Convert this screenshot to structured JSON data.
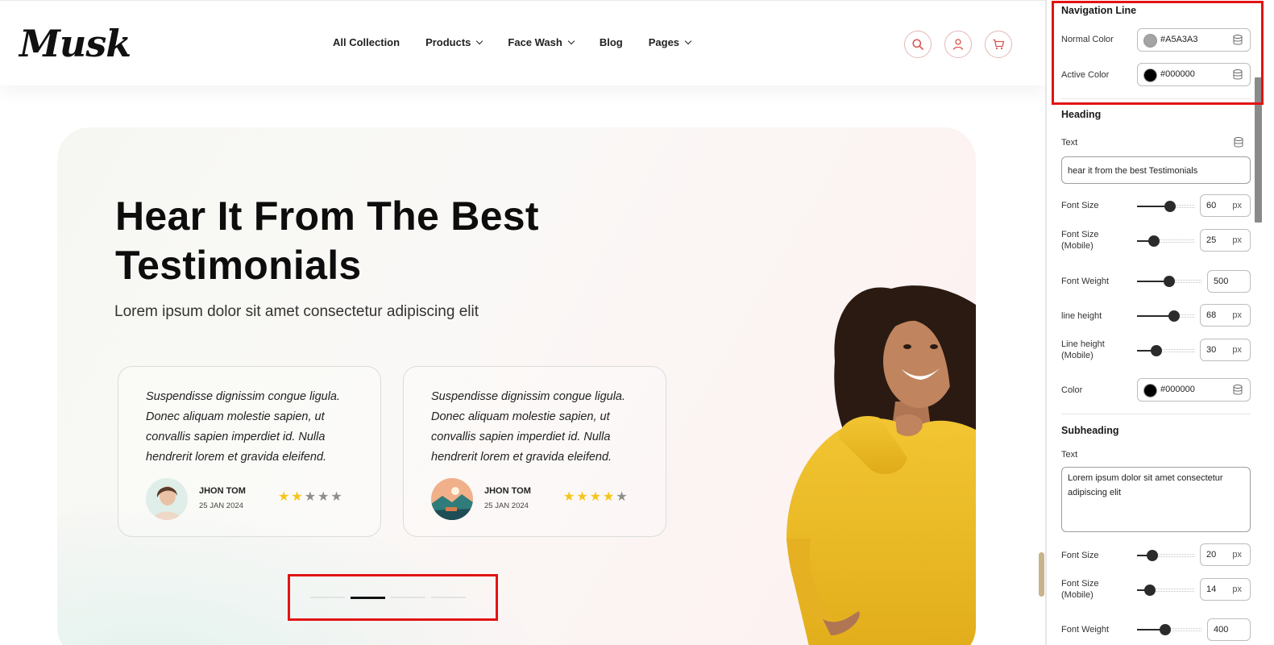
{
  "preview": {
    "logo": "Musk",
    "nav": [
      {
        "label": "All Collection",
        "has_dropdown": false
      },
      {
        "label": "Products",
        "has_dropdown": true
      },
      {
        "label": "Face Wash",
        "has_dropdown": true
      },
      {
        "label": "Blog",
        "has_dropdown": false
      },
      {
        "label": "Pages",
        "has_dropdown": true
      }
    ],
    "header_icons": [
      "search-icon",
      "user-icon",
      "cart-icon"
    ],
    "hero": {
      "title_line1": "Hear It From The Best",
      "title_line2": "Testimonials",
      "subtitle": "Lorem ipsum dolor sit amet consectetur adipiscing elit"
    },
    "testimonials": [
      {
        "quote": "Suspendisse dignissim congue ligula. Donec aliquam molestie sapien, ut convallis sapien imperdiet id. Nulla hendrerit lorem et gravida eleifend.",
        "name": "JHON TOM",
        "date": "25 JAN 2024",
        "rating": 2,
        "max_rating": 5
      },
      {
        "quote": "Suspendisse dignissim congue ligula. Donec aliquam molestie sapien, ut convallis sapien imperdiet id. Nulla hendrerit lorem et gravida eleifend.",
        "name": "JHON TOM",
        "date": "25 JAN 2024",
        "rating": 4,
        "max_rating": 5
      }
    ],
    "pagination": {
      "count": 4,
      "active_index": 1
    },
    "colors": {
      "star_filled": "#F5C518",
      "star_empty": "#8E8E8E",
      "accent_icon": "#D9534F",
      "highlight": "#E11414"
    }
  },
  "panel": {
    "navigation_line": {
      "title": "Navigation Line",
      "normal_color_label": "Normal Color",
      "normal_color": "#A5A3A3",
      "active_color_label": "Active Color",
      "active_color": "#000000"
    },
    "heading": {
      "title": "Heading",
      "text_label": "Text",
      "text_value": "hear it from the best Testimonials",
      "font_size_label": "Font Size",
      "font_size": "60",
      "font_size_mobile_label": "Font Size (Mobile)",
      "font_size_mobile": "25",
      "font_weight_label": "Font Weight",
      "font_weight": "500",
      "line_height_label": "line height",
      "line_height": "68",
      "line_height_mobile_label": "Line height (Mobile)",
      "line_height_mobile": "30",
      "color_label": "Color",
      "color": "#000000",
      "unit": "px"
    },
    "subheading": {
      "title": "Subheading",
      "text_label": "Text",
      "text_value": "Lorem ipsum dolor sit amet consectetur adipiscing elit",
      "font_size_label": "Font Size",
      "font_size": "20",
      "font_size_mobile_label": "Font Size (Mobile)",
      "font_size_mobile": "14",
      "font_weight_label": "Font Weight",
      "font_weight": "400",
      "unit": "px"
    },
    "sliders": {
      "heading_font_size": 0.58,
      "heading_font_size_mobile": 0.3,
      "heading_font_weight": 0.5,
      "heading_line_height": 0.65,
      "heading_line_height_mobile": 0.34,
      "sub_font_size": 0.27,
      "sub_font_size_mobile": 0.22,
      "sub_font_weight": 0.44
    }
  }
}
